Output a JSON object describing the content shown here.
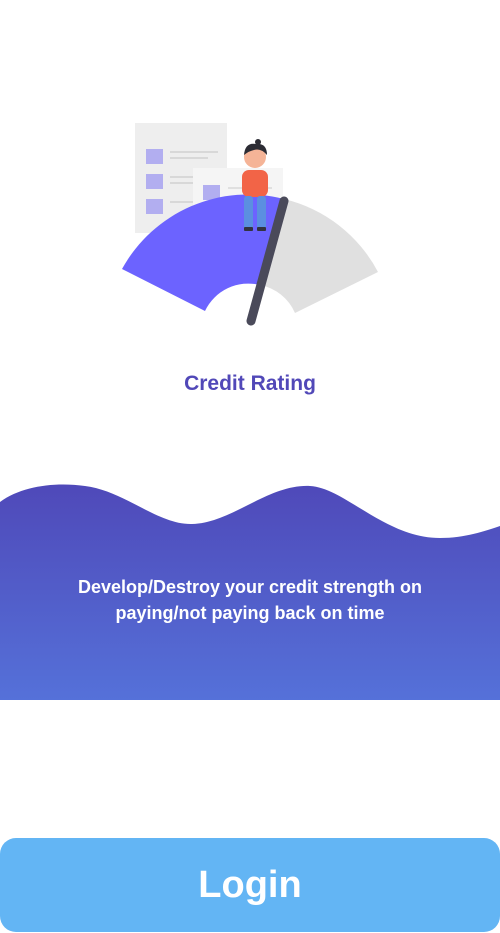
{
  "onboarding": {
    "title": "Credit Rating",
    "description": "Develop/Destroy your credit strength on paying/not paying back on time"
  },
  "login_button": {
    "label": "Login"
  },
  "colors": {
    "title": "#5148b8",
    "wave_top": "#4f49b9",
    "wave_bottom": "#5571d9",
    "button": "#63b5f4",
    "gauge_fill": "#6c63ff",
    "gauge_track": "#e0e0e0"
  },
  "icons": {
    "illustration": "credit-gauge-illustration"
  }
}
